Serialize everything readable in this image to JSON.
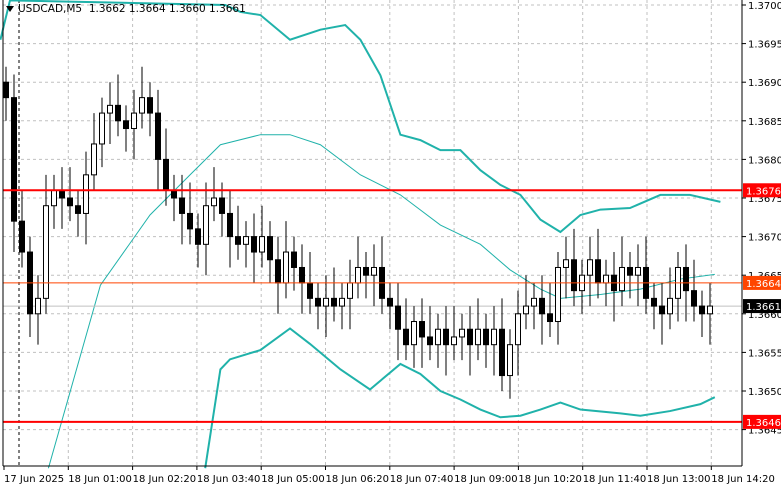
{
  "header": {
    "symbol": "USDCAD,M5",
    "ohlc": "1.3662 1.3664 1.3660 1.3661"
  },
  "colors": {
    "grid": "#c0c0c0",
    "band": "#20b2aa",
    "red_line": "#ff0000",
    "orange_line": "#ff4500",
    "bid": "#000000",
    "candle": "#000000"
  },
  "price_axis": {
    "min": 1.364,
    "max": 1.37006,
    "ticks": [
      "1.3700",
      "1.3695",
      "1.3690",
      "1.3685",
      "1.3680",
      "1.3675",
      "1.3670",
      "1.3665",
      "1.3660",
      "1.3655",
      "1.3650",
      "1.3645"
    ]
  },
  "time_axis": {
    "labels": [
      "17 Jun 2025",
      "18 Jun 01:00",
      "18 Jun 02:20",
      "18 Jun 03:40",
      "18 Jun 05:00",
      "18 Jun 06:20",
      "18 Jun 07:40",
      "18 Jun 09:00",
      "18 Jun 10:20",
      "18 Jun 11:40",
      "18 Jun 13:00",
      "18 Jun 14:20"
    ]
  },
  "levels": [
    {
      "price": 1.3676,
      "label": "1.3676",
      "color": "#ff0000",
      "width": 2
    },
    {
      "price": 1.3664,
      "label": "1.3664",
      "color": "#ff4500",
      "width": 1
    },
    {
      "price": 1.3646,
      "label": "1.3646",
      "color": "#ff0000",
      "width": 2
    }
  ],
  "bid": {
    "price": 1.3661,
    "label": "1.3661"
  },
  "chart_data": {
    "type": "candlestick",
    "closes": [
      1.3688,
      1.3672,
      1.3668,
      1.366,
      1.3662,
      1.3674,
      1.3676,
      1.3675,
      1.3674,
      1.3673,
      1.3678,
      1.3682,
      1.3686,
      1.3687,
      1.3685,
      1.3684,
      1.3686,
      1.3688,
      1.3686,
      1.368,
      1.3676,
      1.3675,
      1.3673,
      1.3671,
      1.3669,
      1.3674,
      1.3675,
      1.3673,
      1.367,
      1.3669,
      1.367,
      1.3668,
      1.367,
      1.3667,
      1.3664,
      1.3668,
      1.3666,
      1.3664,
      1.3662,
      1.3661,
      1.3662,
      1.3661,
      1.3662,
      1.3664,
      1.3666,
      1.3665,
      1.3666,
      1.3662,
      1.3661,
      1.3658,
      1.3656,
      1.3659,
      1.3657,
      1.3656,
      1.3658,
      1.3656,
      1.3657,
      1.3658,
      1.3656,
      1.3658,
      1.3656,
      1.3658,
      1.3652,
      1.3656,
      1.366,
      1.3661,
      1.3662,
      1.366,
      1.3659,
      1.3666,
      1.3667,
      1.3663,
      1.3665,
      1.3667,
      1.3664,
      1.3665,
      1.3663,
      1.3666,
      1.3665,
      1.3666,
      1.3662,
      1.3661,
      1.366,
      1.3662,
      1.3666,
      1.3663,
      1.3661,
      1.366,
      1.3661
    ],
    "bb_upper": [
      [
        -0.7,
        1.36955
      ],
      [
        0.5,
        1.37006
      ],
      [
        27.4,
        1.37
      ],
      [
        29.3,
        1.36991
      ],
      [
        31.8,
        1.36987
      ],
      [
        35.5,
        1.36955
      ],
      [
        39.3,
        1.36968
      ],
      [
        42.4,
        1.36974
      ],
      [
        44.3,
        1.36955
      ],
      [
        46.8,
        1.36909
      ],
      [
        49.3,
        1.36832
      ],
      [
        51.8,
        1.36825
      ],
      [
        54.3,
        1.36812
      ],
      [
        56.8,
        1.36812
      ],
      [
        59.3,
        1.36786
      ],
      [
        61.8,
        1.36767
      ],
      [
        64.3,
        1.36754
      ],
      [
        66.8,
        1.36722
      ],
      [
        69.3,
        1.36706
      ],
      [
        71.8,
        1.36728
      ],
      [
        74.3,
        1.36735
      ],
      [
        78,
        1.36737
      ],
      [
        81.8,
        1.36754
      ],
      [
        85.5,
        1.36754
      ],
      [
        89.3,
        1.36745
      ]
    ],
    "bb_middle": [
      [
        5.3,
        1.364
      ],
      [
        11.8,
        1.36637
      ],
      [
        18,
        1.36728
      ],
      [
        23,
        1.3678
      ],
      [
        26.8,
        1.36819
      ],
      [
        31.8,
        1.36832
      ],
      [
        35.5,
        1.36832
      ],
      [
        39.3,
        1.36819
      ],
      [
        44.3,
        1.3678
      ],
      [
        49.3,
        1.36754
      ],
      [
        54.3,
        1.36715
      ],
      [
        59.3,
        1.3669
      ],
      [
        63,
        1.36657
      ],
      [
        66.8,
        1.36632
      ],
      [
        69.3,
        1.3662
      ],
      [
        74.3,
        1.36625
      ],
      [
        79.3,
        1.36632
      ],
      [
        84.3,
        1.36645
      ],
      [
        88.6,
        1.36651
      ]
    ],
    "bb_lower": [
      [
        24.9,
        1.364
      ],
      [
        26.8,
        1.36528
      ],
      [
        28,
        1.36541
      ],
      [
        31.8,
        1.36553
      ],
      [
        35.5,
        1.36581
      ],
      [
        38,
        1.36561
      ],
      [
        41.8,
        1.36528
      ],
      [
        45.5,
        1.36502
      ],
      [
        49.3,
        1.36535
      ],
      [
        51.8,
        1.36522
      ],
      [
        54.3,
        1.365
      ],
      [
        56.8,
        1.36489
      ],
      [
        59.3,
        1.36476
      ],
      [
        61.8,
        1.36466
      ],
      [
        64.3,
        1.36468
      ],
      [
        66.8,
        1.36476
      ],
      [
        69.3,
        1.36485
      ],
      [
        71.8,
        1.36476
      ],
      [
        76.8,
        1.36471
      ],
      [
        79.3,
        1.36468
      ],
      [
        83,
        1.36474
      ],
      [
        86.8,
        1.36483
      ],
      [
        88.6,
        1.36492
      ]
    ]
  }
}
